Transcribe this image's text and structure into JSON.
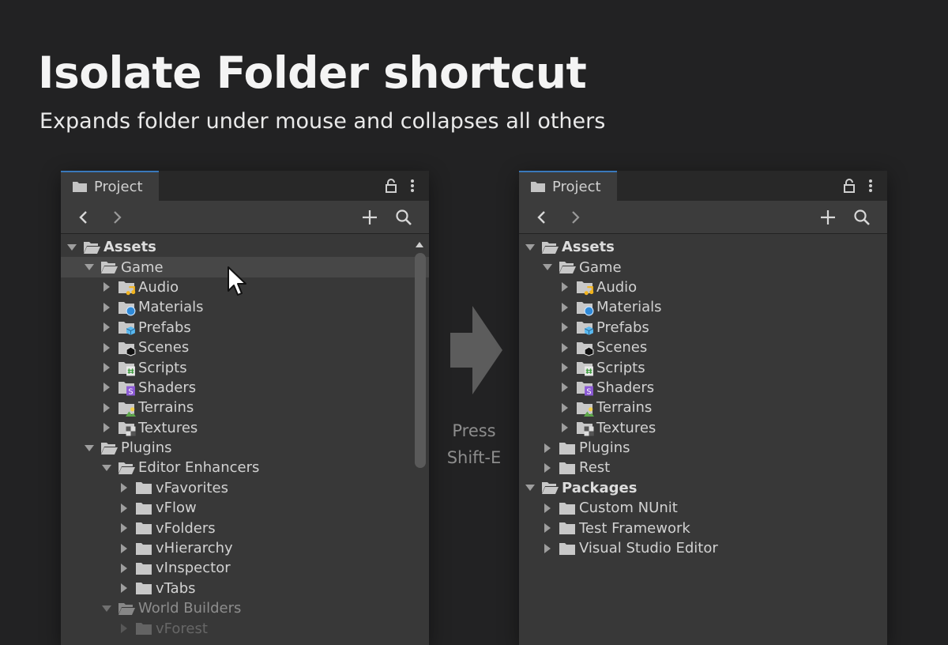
{
  "headline": "Isolate Folder shortcut",
  "subheadline": "Expands folder under mouse and collapses all others",
  "instruction": {
    "line1": "Press",
    "line2": "Shift-E"
  },
  "panel_left": {
    "tab_label": "Project",
    "rows": [
      {
        "label": "Assets",
        "depth": 0,
        "expanded": true,
        "bold": true,
        "icon": "folder-open"
      },
      {
        "label": "Game",
        "depth": 1,
        "expanded": true,
        "icon": "folder-open",
        "highlight": true
      },
      {
        "label": "Audio",
        "depth": 2,
        "expanded": false,
        "icon": "folder",
        "badge": "audio"
      },
      {
        "label": "Materials",
        "depth": 2,
        "expanded": false,
        "icon": "folder",
        "badge": "material"
      },
      {
        "label": "Prefabs",
        "depth": 2,
        "expanded": false,
        "icon": "folder",
        "badge": "prefab"
      },
      {
        "label": "Scenes",
        "depth": 2,
        "expanded": false,
        "icon": "folder",
        "badge": "scene"
      },
      {
        "label": "Scripts",
        "depth": 2,
        "expanded": false,
        "icon": "folder",
        "badge": "script"
      },
      {
        "label": "Shaders",
        "depth": 2,
        "expanded": false,
        "icon": "folder",
        "badge": "shader"
      },
      {
        "label": "Terrains",
        "depth": 2,
        "expanded": false,
        "icon": "folder",
        "badge": "terrain"
      },
      {
        "label": "Textures",
        "depth": 2,
        "expanded": false,
        "icon": "folder",
        "badge": "texture"
      },
      {
        "label": "Plugins",
        "depth": 1,
        "expanded": true,
        "icon": "folder-open"
      },
      {
        "label": "Editor Enhancers",
        "depth": 2,
        "expanded": true,
        "icon": "folder-open"
      },
      {
        "label": "vFavorites",
        "depth": 3,
        "expanded": false,
        "icon": "folder"
      },
      {
        "label": "vFlow",
        "depth": 3,
        "expanded": false,
        "icon": "folder"
      },
      {
        "label": "vFolders",
        "depth": 3,
        "expanded": false,
        "icon": "folder"
      },
      {
        "label": "vHierarchy",
        "depth": 3,
        "expanded": false,
        "icon": "folder"
      },
      {
        "label": "vInspector",
        "depth": 3,
        "expanded": false,
        "icon": "folder"
      },
      {
        "label": "vTabs",
        "depth": 3,
        "expanded": false,
        "icon": "folder"
      },
      {
        "label": "World Builders",
        "depth": 2,
        "expanded": true,
        "icon": "folder-open",
        "fade": 1
      },
      {
        "label": "vForest",
        "depth": 3,
        "expanded": false,
        "icon": "folder",
        "fade": 2
      }
    ]
  },
  "panel_right": {
    "tab_label": "Project",
    "rows": [
      {
        "label": "Assets",
        "depth": 0,
        "expanded": true,
        "bold": true,
        "icon": "folder-open"
      },
      {
        "label": "Game",
        "depth": 1,
        "expanded": true,
        "icon": "folder-open"
      },
      {
        "label": "Audio",
        "depth": 2,
        "expanded": false,
        "icon": "folder",
        "badge": "audio"
      },
      {
        "label": "Materials",
        "depth": 2,
        "expanded": false,
        "icon": "folder",
        "badge": "material"
      },
      {
        "label": "Prefabs",
        "depth": 2,
        "expanded": false,
        "icon": "folder",
        "badge": "prefab"
      },
      {
        "label": "Scenes",
        "depth": 2,
        "expanded": false,
        "icon": "folder",
        "badge": "scene"
      },
      {
        "label": "Scripts",
        "depth": 2,
        "expanded": false,
        "icon": "folder",
        "badge": "script"
      },
      {
        "label": "Shaders",
        "depth": 2,
        "expanded": false,
        "icon": "folder",
        "badge": "shader"
      },
      {
        "label": "Terrains",
        "depth": 2,
        "expanded": false,
        "icon": "folder",
        "badge": "terrain"
      },
      {
        "label": "Textures",
        "depth": 2,
        "expanded": false,
        "icon": "folder",
        "badge": "texture"
      },
      {
        "label": "Plugins",
        "depth": 1,
        "expanded": false,
        "icon": "folder"
      },
      {
        "label": "Rest",
        "depth": 1,
        "expanded": false,
        "icon": "folder"
      },
      {
        "label": "Packages",
        "depth": 0,
        "expanded": true,
        "bold": true,
        "icon": "folder-open"
      },
      {
        "label": "Custom NUnit",
        "depth": 1,
        "expanded": false,
        "icon": "folder"
      },
      {
        "label": "Test Framework",
        "depth": 1,
        "expanded": false,
        "icon": "folder"
      },
      {
        "label": "Visual Studio Editor",
        "depth": 1,
        "expanded": false,
        "icon": "folder"
      }
    ]
  }
}
